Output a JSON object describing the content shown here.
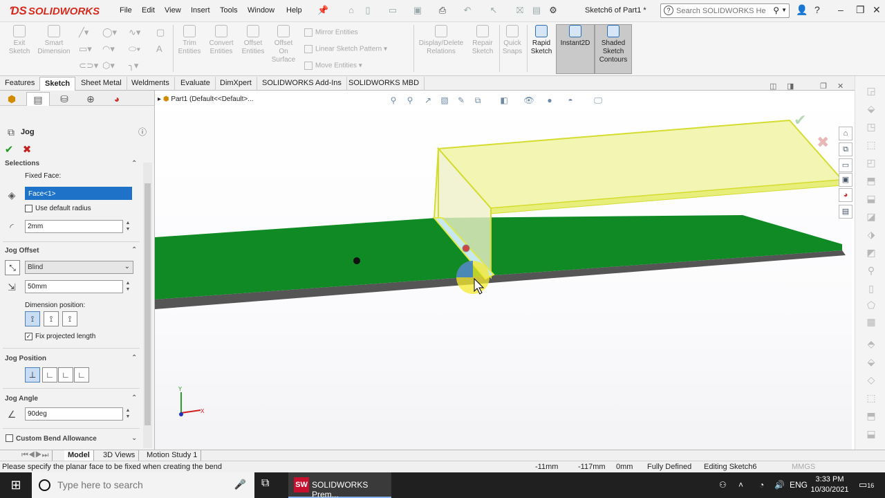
{
  "app": {
    "logo_text": "SOLIDWORKS",
    "document_title": "Sketch6 of Part1 *",
    "menu": [
      "File",
      "Edit",
      "View",
      "Insert",
      "Tools",
      "Window",
      "Help"
    ],
    "search": {
      "placeholder": "Search SOLIDWORKS Help"
    }
  },
  "ribbon": {
    "buttons": {
      "exit_sketch": "Exit Sketch",
      "smart_dimension": "Smart Dimension",
      "trim_entities": "Trim Entities",
      "convert_entities": "Convert Entities",
      "offset_entities": "Offset Entities",
      "offset_on_surface": "Offset On Surface",
      "mirror_entities": "Mirror Entities",
      "linear_sketch_pattern": "Linear Sketch Pattern",
      "move_entities": "Move Entities",
      "display_delete_relations": "Display/Delete Relations",
      "repair_sketch": "Repair Sketch",
      "quick_snaps": "Quick Snaps",
      "rapid_sketch": "Rapid Sketch",
      "instant2d": "Instant2D",
      "shaded_sketch_contours": "Shaded Sketch Contours"
    }
  },
  "tabs": [
    "Features",
    "Sketch",
    "Sheet Metal",
    "Weldments",
    "Evaluate",
    "DimXpert",
    "SOLIDWORKS Add-Ins",
    "SOLIDWORKS MBD"
  ],
  "active_tab": "Sketch",
  "property_manager": {
    "title": "Jog",
    "sections": {
      "selections": "Selections",
      "fixed_face_label": "Fixed Face:",
      "fixed_face_value": "Face<1>",
      "use_default_radius": "Use default radius",
      "use_default_radius_checked": false,
      "bend_radius": "2mm",
      "jog_offset": "Jog Offset",
      "end_condition": "Blind",
      "offset_distance": "50mm",
      "dimension_position": "Dimension position:",
      "fix_projected_length": "Fix projected length",
      "fix_projected_length_checked": true,
      "jog_position": "Jog Position",
      "jog_angle": "Jog Angle",
      "angle_value": "90deg",
      "custom_bend_allowance": "Custom Bend Allowance",
      "custom_bend_allowance_checked": false
    }
  },
  "viewport": {
    "breadcrumb": "Part1  (Default<<Default>...",
    "triad": {
      "x": "X",
      "y": "Y"
    }
  },
  "bottom_tabs": [
    "Model",
    "3D Views",
    "Motion Study 1"
  ],
  "active_bottom_tab": "Model",
  "status_bar": {
    "message": "Please specify the planar face to be fixed when creating the bend",
    "x": "-11mm",
    "y": "-117mm",
    "z": "0mm",
    "state": "Fully Defined",
    "editing": "Editing Sketch6",
    "units": "MMGS"
  },
  "taskbar": {
    "search_placeholder": "Type here to search",
    "app_label": "SOLIDWORKS Prem...",
    "app_badge": "SW",
    "language": "ENG",
    "time": "3:33 PM",
    "date": "10/30/2021",
    "notification_count": "16"
  },
  "colors": {
    "base_plate": "#0f8a24",
    "jog_preview": "#f1f3a6",
    "brand": "#d52b1e",
    "selection": "#1e72c8"
  }
}
